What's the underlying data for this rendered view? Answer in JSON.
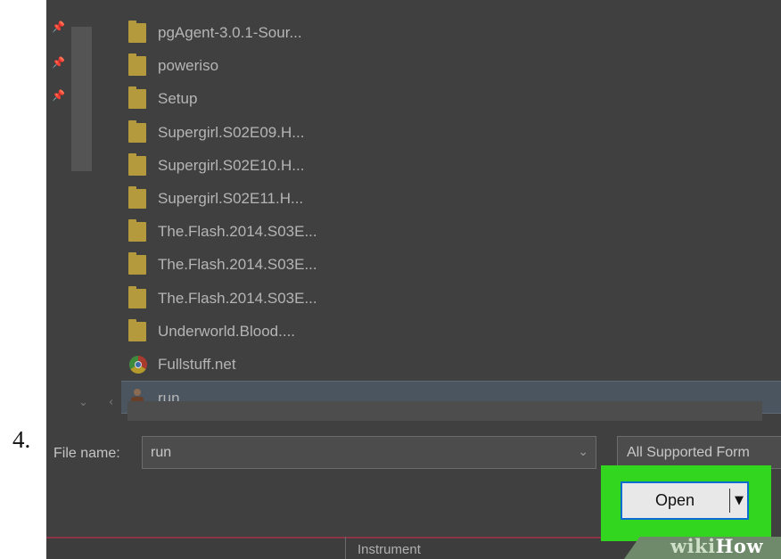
{
  "step_number": "4.",
  "files": [
    {
      "name": "pgAgent-3.0.1-Sour...",
      "icon": "folder-icon"
    },
    {
      "name": "poweriso",
      "icon": "folder-icon"
    },
    {
      "name": "Setup",
      "icon": "folder-icon"
    },
    {
      "name": "Supergirl.S02E09.H...",
      "icon": "folder-icon"
    },
    {
      "name": "Supergirl.S02E10.H...",
      "icon": "folder-icon"
    },
    {
      "name": "Supergirl.S02E11.H...",
      "icon": "folder-icon"
    },
    {
      "name": "The.Flash.2014.S03E...",
      "icon": "folder-icon"
    },
    {
      "name": "The.Flash.2014.S03E...",
      "icon": "folder-icon"
    },
    {
      "name": "The.Flash.2014.S03E...",
      "icon": "folder-icon"
    },
    {
      "name": "Underworld.Blood....",
      "icon": "folder-icon"
    },
    {
      "name": "Fullstuff.net",
      "icon": "chrome-icon"
    },
    {
      "name": "run",
      "icon": "exe-icon",
      "selected": true
    }
  ],
  "file_name": {
    "label": "File name:",
    "value": "run"
  },
  "file_type": {
    "selected": "All Supported Form"
  },
  "open_button": {
    "label": "Open"
  },
  "bottom_bar": {
    "label": "Instrument"
  },
  "watermark": {
    "wiki": "wiki",
    "how": "How"
  },
  "colors": {
    "highlight": "#33d61f",
    "focus_border": "#0a6bd1",
    "folder": "#b59a3d"
  }
}
